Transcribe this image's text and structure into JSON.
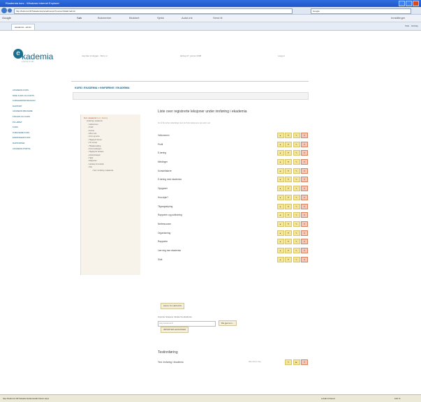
{
  "browser": {
    "window_title": "Ekademia kurs - Windows Internet Explorer",
    "url": "http://kulturo1.007/ekademia/no/edit.aspx?course=3&tab=admin",
    "search_placeholder": "Google",
    "google_label": "Google",
    "google_search_button": "Søk",
    "google_items": [
      "Bokmerker",
      "Blokkert",
      "Sjekk",
      "AutoLink",
      "Send til",
      "Innstillinger"
    ],
    "tab_label": "ekademia - admin",
    "tools": [
      "Side",
      "Verktøy"
    ],
    "status_text": "http://kulturo1.007/ekademia/kurs/adminkurs.aspx",
    "status_right": [
      "Lokalt intranett",
      "100 %"
    ]
  },
  "logo": {
    "word": "kademia",
    "letter": "e",
    "tagline": "e-læring for alle"
  },
  "top": {
    "left": "Jeg ikke innlogget - Skriv ut",
    "center": "lørdag 27. januar 2008",
    "right": "Logg ut"
  },
  "sidebar": [
    "AKADEMIA KURS",
    "MINE KURS OG KORTS",
    "KURSADMINISTRASJON",
    "RAPPORT",
    "AKADEMIA BRUKERE",
    "FÅKURS OG KURS",
    "PÅ LØPET",
    "KURS",
    "PUBLISERE KURS",
    "ENDRINGER KURS",
    "RAPPORTER",
    "AKADEMIA PORTAL"
  ],
  "breadcrumb": "KURS / EKADEMIA  >  INNFØRING I EKADEMIA",
  "tree": {
    "title": "Kurs i ekademia",
    "title_suffix": "Kurs i tiltaking",
    "subtitle": "Innføring i ekademia",
    "items": [
      "Velkommen",
      "Profil",
      "Kurset",
      "Mine kurs",
      "Kurs og tema",
      "Tilgang til kurset",
      "Om kurset",
      "Tilbakemelding",
      "Kommunikasjon",
      "Tilgang for brukere",
      "Administrasjon",
      "Hjelp",
      "Rapporter",
      "Verktøy for innhold",
      "Test",
      "Test: Innføring i ekademia"
    ]
  },
  "content": {
    "heading": "Liste over registrerte leksjoner under innføring i ekademia",
    "description": "For å få endret rekkefølgen kan du flytte leksjonene opp eller ned",
    "lessons": [
      "Velkommen",
      "Profil",
      "E-læring",
      "Meldinger",
      "Kursdeltakere",
      "E-læring med ekademia",
      "Oppgaver",
      "Hva skjer?",
      "Tilgangsstyring",
      "Rapporter og publisering",
      "Nettressurser",
      "Organisering",
      "Rapporter",
      "Lær deg mer ekademia",
      "Slutt"
    ],
    "icon_labels": [
      "Opp",
      "Ned",
      "Rediger",
      "Slett"
    ],
    "add_lesson_button": "LEGG TIL LEKSJON",
    "import_label": "Importer leksjoner direkte fra ekademia",
    "import_placeholder": "Velg ekademia-fil",
    "browse_button": "Bla gjennom...",
    "import_button": "IMPORTER LEKSJONER",
    "test_heading": "Testinnføring",
    "test_row": "Test: Innføring i ekademia",
    "test_row_meta": "Ikke tatt av deg"
  }
}
